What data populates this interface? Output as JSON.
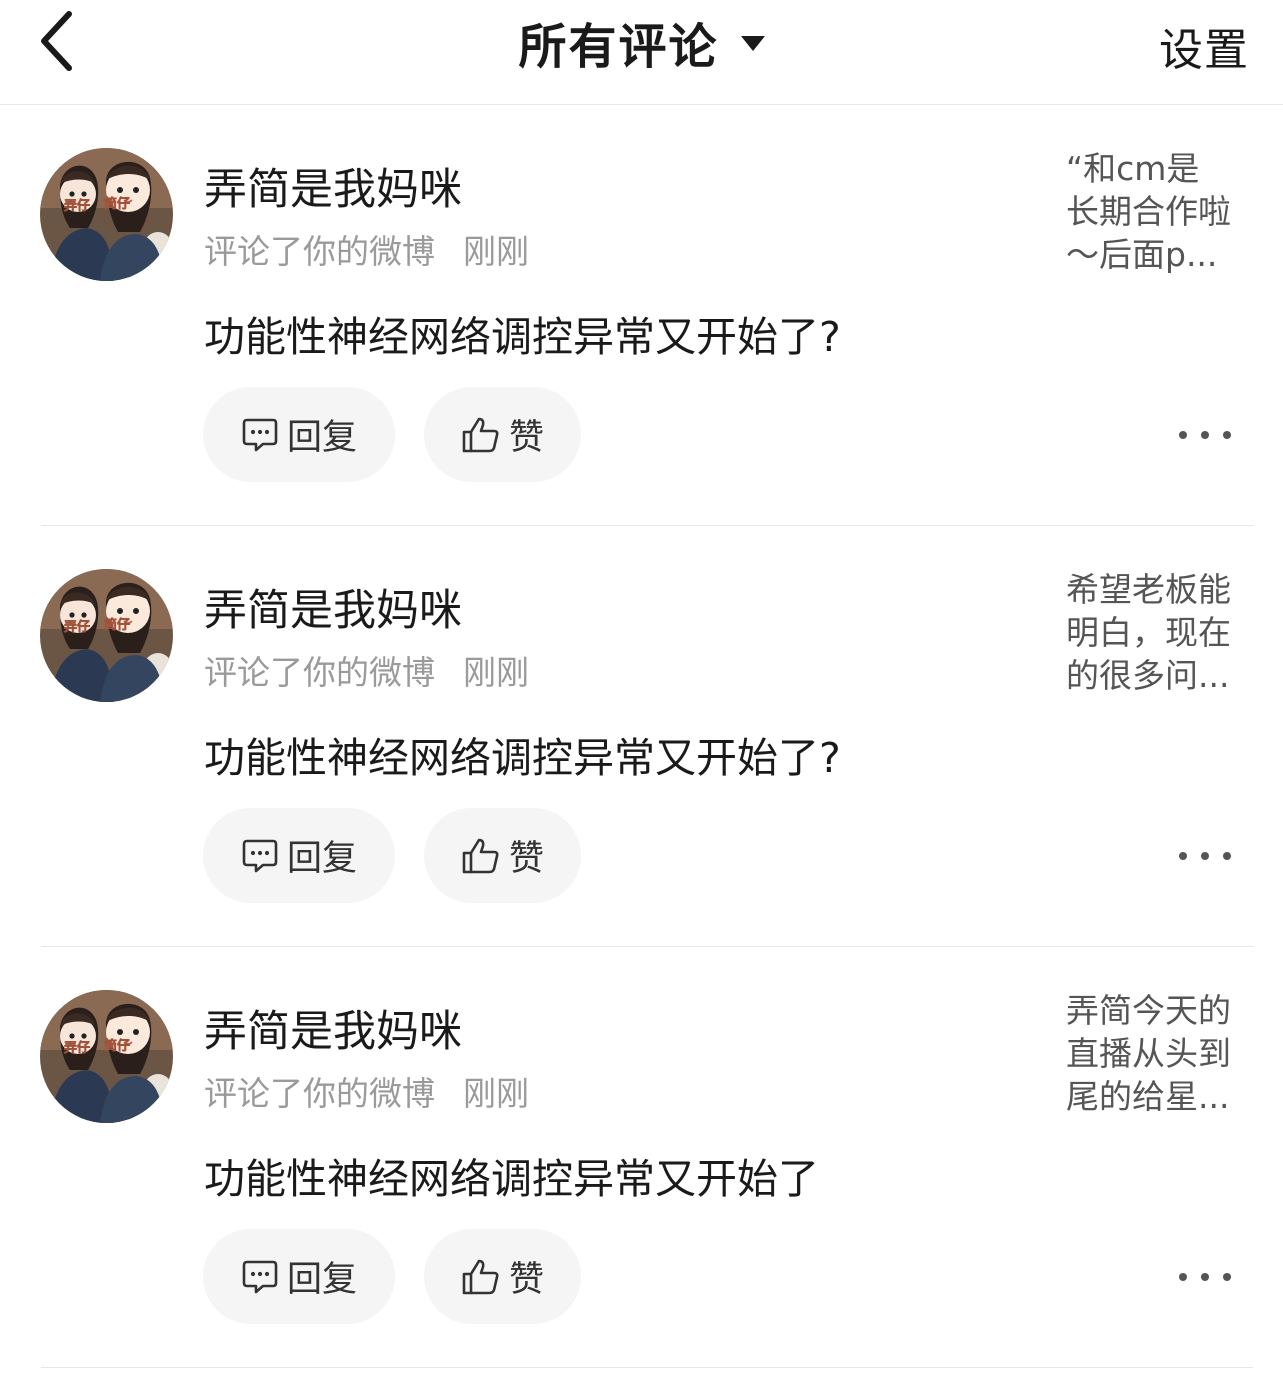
{
  "header": {
    "back_icon": "chevron-left-icon",
    "title": "所有评论",
    "title_dropdown_icon": "caret-down-icon",
    "settings_label": "设置"
  },
  "comments": [
    {
      "username": "弄简是我妈咪",
      "action": "评论了你的微博",
      "time": "刚刚",
      "text": "功能性神经网络调控异常又开始了?",
      "source_lines": [
        "“和cm是",
        "长期合作啦",
        "～后面p..."
      ],
      "reply_label": "回复",
      "like_label": "赞",
      "avatar_labels": [
        "弄仔",
        "简仔"
      ]
    },
    {
      "username": "弄简是我妈咪",
      "action": "评论了你的微博",
      "time": "刚刚",
      "text": "功能性神经网络调控异常又开始了?",
      "source_lines": [
        "希望老板能",
        "明白，现在",
        "的很多问..."
      ],
      "reply_label": "回复",
      "like_label": "赞",
      "avatar_labels": [
        "弄仔",
        "简仔"
      ]
    },
    {
      "username": "弄简是我妈咪",
      "action": "评论了你的微博",
      "time": "刚刚",
      "text": "功能性神经网络调控异常又开始了",
      "source_lines": [
        "弄简今天的",
        "直播从头到",
        "尾的给星..."
      ],
      "reply_label": "回复",
      "like_label": "赞",
      "avatar_labels": [
        "弄仔",
        "简仔"
      ]
    }
  ],
  "icons": {
    "reply": "comment-bubble-icon",
    "like": "thumbs-up-icon",
    "more": "more-dots-icon"
  },
  "colors": {
    "primary_text": "#1a1a1a",
    "secondary_text": "#9a9a9a",
    "pill_background": "#f5f5f5",
    "divider": "#e6e6e6"
  }
}
